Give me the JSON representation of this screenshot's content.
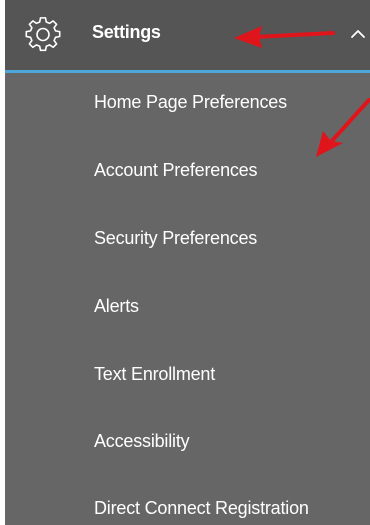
{
  "header": {
    "label": "Settings",
    "icon": "gear-icon",
    "expanded_icon": "chevron-up-icon",
    "accent_color": "#4fa6d8"
  },
  "menu": {
    "items": [
      {
        "label": "Home Page Preferences"
      },
      {
        "label": "Account Preferences"
      },
      {
        "label": "Security Preferences"
      },
      {
        "label": "Alerts"
      },
      {
        "label": "Text Enrollment"
      },
      {
        "label": "Accessibility"
      },
      {
        "label": "Direct Connect Registration"
      }
    ]
  },
  "annotations": {
    "arrow_color": "#e0141b"
  }
}
